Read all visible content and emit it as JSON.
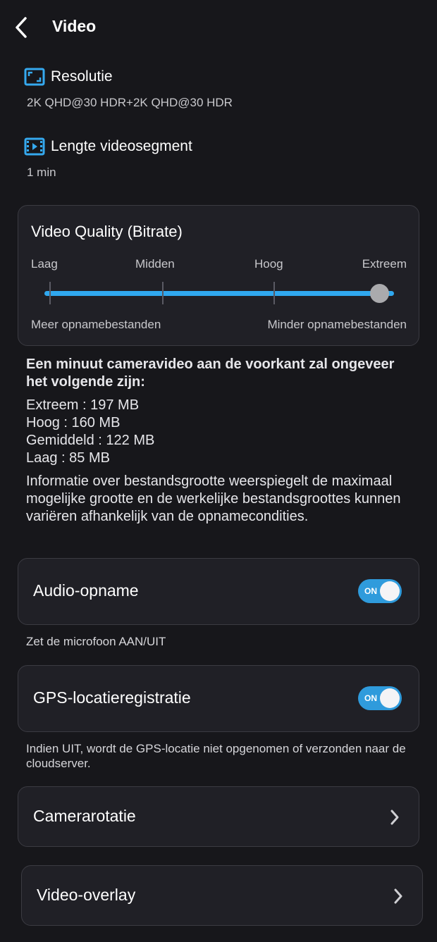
{
  "header": {
    "title": "Video"
  },
  "resolution": {
    "title": "Resolutie",
    "value": "2K QHD@30 HDR+2K QHD@30 HDR"
  },
  "segment": {
    "title": "Lengte videosegment",
    "value": "1 min"
  },
  "quality": {
    "title": "Video Quality (Bitrate)",
    "levels": [
      "Laag",
      "Midden",
      "Hoog",
      "Extreem"
    ],
    "selected": "Extreem",
    "hint_left": "Meer opnamebestanden",
    "hint_right": "Minder opnamebestanden"
  },
  "info": {
    "heading": "Een minuut cameravideo aan de voorkant zal ongeveer het volgende zijn:",
    "lines": [
      "Extreem : 197 MB",
      "Hoog : 160 MB",
      "Gemiddeld : 122 MB",
      "Laag : 85 MB"
    ],
    "note": "Informatie over bestandsgrootte weerspiegelt de maximaal mogelijke grootte en de werkelijke bestandsgroottes kunnen variëren afhankelijk van de opnamecondities."
  },
  "audio": {
    "label": "Audio-opname",
    "state": "ON",
    "caption": "Zet de microfoon AAN/UIT"
  },
  "gps": {
    "label": "GPS-locatieregistratie",
    "state": "ON",
    "caption": "Indien UIT, wordt de GPS-locatie niet opgenomen of verzonden naar de cloudserver."
  },
  "rotation": {
    "label": "Camerarotatie"
  },
  "overlay": {
    "label": "Video-overlay"
  },
  "colors": {
    "background": "#17171b",
    "card": "#202026",
    "accent": "#30a8ef",
    "icon": "#35a9ef"
  }
}
